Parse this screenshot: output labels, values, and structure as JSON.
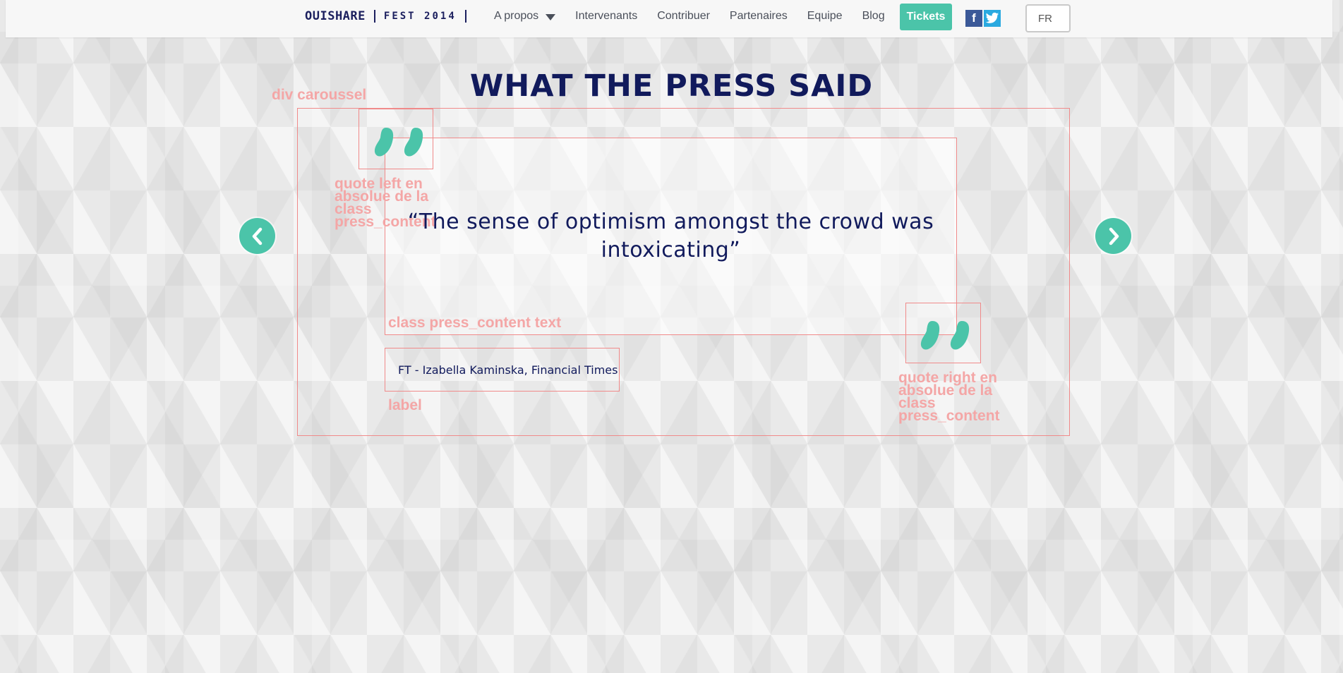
{
  "nav": {
    "logo_brand": "OUISHARE",
    "logo_event": "FEST 2014",
    "links": [
      {
        "label": "A propos",
        "has_dropdown": true
      },
      {
        "label": "Intervenants"
      },
      {
        "label": "Contribuer"
      },
      {
        "label": "Partenaires"
      },
      {
        "label": "Equipe"
      },
      {
        "label": "Blog"
      }
    ],
    "tickets_label": "Tickets",
    "facebook_glyph": "f",
    "language": "FR"
  },
  "section": {
    "title": "WHAT THE PRESS SAID"
  },
  "press": {
    "quote": "“The sense of optimism amongst the crowd was intoxicating”",
    "source": "FT - Izabella Kaminska, Financial Times"
  },
  "annotations": {
    "carousel": "div caroussel",
    "quote_left": "quote left en absolue de la class press_content",
    "press_content": "class press_content text",
    "label": "label",
    "quote_right": "quote right en absolue de la class press_content"
  },
  "colors": {
    "accent": "#4bc4a9",
    "navy": "#111a5c",
    "annotation": "#f08a8a"
  },
  "icons": [
    "caret-down-icon",
    "facebook-icon",
    "twitter-icon",
    "quote-left-icon",
    "quote-right-icon",
    "chevron-left-icon",
    "chevron-right-icon"
  ]
}
